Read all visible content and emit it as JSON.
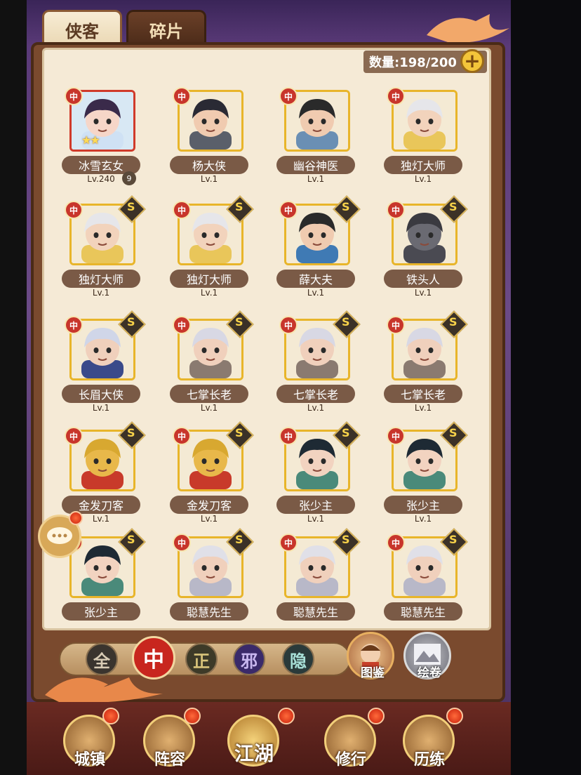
{
  "tabs": [
    {
      "label": "侠客",
      "active": true
    },
    {
      "label": "碎片",
      "active": false
    }
  ],
  "count_text": "数量:198/200",
  "heroes": [
    {
      "name": "冰雪玄女",
      "level": "Lv.240",
      "rank": "9",
      "stars": "★★",
      "skin": "#f6d6c8",
      "hair": "#3a2a4a",
      "robe": "#cfe1f4",
      "frame": "red",
      "s": false
    },
    {
      "name": "杨大侠",
      "level": "Lv.1",
      "skin": "#f0cbb0",
      "hair": "#2a2a34",
      "robe": "#5a5f6a",
      "frame": "gold",
      "s": false
    },
    {
      "name": "幽谷神医",
      "level": "Lv.1",
      "skin": "#f0cbb0",
      "hair": "#2a2a2a",
      "robe": "#6a8fb4",
      "frame": "gold",
      "s": false
    },
    {
      "name": "独灯大师",
      "level": "Lv.1",
      "skin": "#f2d3bc",
      "hair": "#e6e6ea",
      "robe": "#e9c65a",
      "frame": "gold",
      "s": false
    },
    {
      "name": "独灯大师",
      "level": "Lv.1",
      "skin": "#f2d3bc",
      "hair": "#e6e6ea",
      "robe": "#e9c65a",
      "frame": "gold",
      "s": true
    },
    {
      "name": "独灯大师",
      "level": "Lv.1",
      "skin": "#f2d3bc",
      "hair": "#e6e6ea",
      "robe": "#e9c65a",
      "frame": "gold",
      "s": true
    },
    {
      "name": "薛大夫",
      "level": "Lv.1",
      "skin": "#f0cbb0",
      "hair": "#2a2a2a",
      "robe": "#3f7ab4",
      "frame": "gold",
      "s": true
    },
    {
      "name": "铁头人",
      "level": "Lv.1",
      "skin": "#6a6a72",
      "hair": "#3a3a40",
      "robe": "#4a4a52",
      "frame": "gold",
      "s": true
    },
    {
      "name": "长眉大侠",
      "level": "Lv.1",
      "skin": "#f0d0bc",
      "hair": "#d0d6e8",
      "robe": "#3a4a8a",
      "frame": "gold",
      "s": true
    },
    {
      "name": "七掌长老",
      "level": "Lv.1",
      "skin": "#f0d0bc",
      "hair": "#d8d8e4",
      "robe": "#8a7a70",
      "frame": "gold",
      "s": true
    },
    {
      "name": "七掌长老",
      "level": "Lv.1",
      "skin": "#f0d0bc",
      "hair": "#d8d8e4",
      "robe": "#8a7a70",
      "frame": "gold",
      "s": true
    },
    {
      "name": "七掌长老",
      "level": "Lv.1",
      "skin": "#f0d0bc",
      "hair": "#d8d8e4",
      "robe": "#8a7a70",
      "frame": "gold",
      "s": true
    },
    {
      "name": "金发刀客",
      "level": "Lv.1",
      "skin": "#e8b84a",
      "hair": "#d8a830",
      "robe": "#c83a2a",
      "frame": "gold",
      "s": true
    },
    {
      "name": "金发刀客",
      "level": "Lv.1",
      "skin": "#e8b84a",
      "hair": "#d8a830",
      "robe": "#c83a2a",
      "frame": "gold",
      "s": true
    },
    {
      "name": "张少主",
      "level": "Lv.1",
      "skin": "#f2d3c0",
      "hair": "#1e2a34",
      "robe": "#4a8a7a",
      "frame": "gold",
      "s": true
    },
    {
      "name": "张少主",
      "level": "Lv.1",
      "skin": "#f2d3c0",
      "hair": "#1e2a34",
      "robe": "#4a8a7a",
      "frame": "gold",
      "s": true
    },
    {
      "name": "张少主",
      "level": "",
      "skin": "#f2d3c0",
      "hair": "#1e2a34",
      "robe": "#4a8a7a",
      "frame": "gold",
      "s": true
    },
    {
      "name": "聪慧先生",
      "level": "",
      "skin": "#f0d0bc",
      "hair": "#e0e0e8",
      "robe": "#b8b8c8",
      "frame": "gold",
      "s": true
    },
    {
      "name": "聪慧先生",
      "level": "",
      "skin": "#f0d0bc",
      "hair": "#e0e0e8",
      "robe": "#b8b8c8",
      "frame": "gold",
      "s": true
    },
    {
      "name": "聪慧先生",
      "level": "",
      "skin": "#f0d0bc",
      "hair": "#e0e0e8",
      "robe": "#b8b8c8",
      "frame": "gold",
      "s": true
    }
  ],
  "filters": [
    {
      "label": "全",
      "bg": "#3a342e",
      "color": "#d8cbb4"
    },
    {
      "label": "中",
      "bg": "#c8261e",
      "color": "#ffffff"
    },
    {
      "label": "正",
      "bg": "#3d3a28",
      "color": "#d8c37a"
    },
    {
      "label": "邪",
      "bg": "#3a2a6a",
      "color": "#c9b8f0"
    },
    {
      "label": "隐",
      "bg": "#2a3a3a",
      "color": "#a8e0d8"
    }
  ],
  "side_buttons": [
    {
      "label": "图鉴"
    },
    {
      "label": "绘卷"
    }
  ],
  "nav": [
    {
      "label": "城镇"
    },
    {
      "label": "阵容"
    },
    {
      "label": "江湖"
    },
    {
      "label": "修行"
    },
    {
      "label": "历练"
    }
  ]
}
